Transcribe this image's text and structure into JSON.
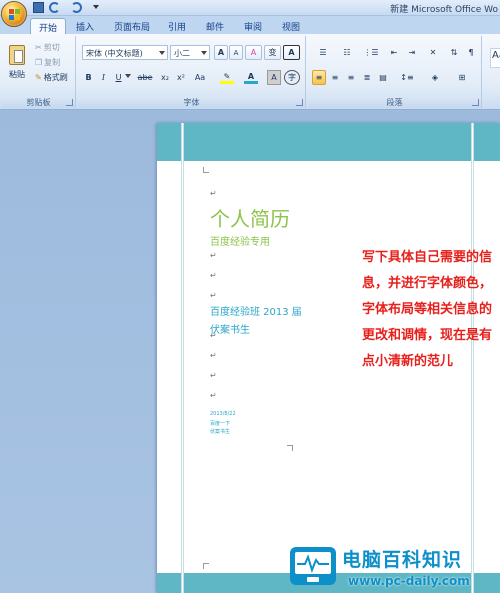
{
  "window": {
    "title": "新建 Microsoft Office Wo"
  },
  "tabs": [
    {
      "label": "开始",
      "active": true
    },
    {
      "label": "插入"
    },
    {
      "label": "页面布局"
    },
    {
      "label": "引用"
    },
    {
      "label": "邮件"
    },
    {
      "label": "审阅"
    },
    {
      "label": "视图"
    }
  ],
  "clipboard": {
    "paste_label": "粘贴",
    "cut_label": "剪切",
    "copy_label": "复制",
    "format_painter_label": "格式刷",
    "group_label": "剪贴板"
  },
  "font": {
    "font_name": "宋体 (中文标题)",
    "font_size": "小二",
    "group_label": "字体",
    "buttons": {
      "bold": "B",
      "italic": "I",
      "underline": "U",
      "strike": "abe",
      "subscript": "x₂",
      "superscript": "x²",
      "change_case": "Aa",
      "font_color": "A",
      "char_shading": "A",
      "grow": "A",
      "shrink": "A",
      "clear": "A",
      "phonetic": "变"
    }
  },
  "paragraph": {
    "group_label": "段落"
  },
  "styles": {
    "preview": "Aa"
  },
  "document": {
    "title": "个人简历",
    "subtitle": "百度经验专用",
    "line1": "百度经验班 2013 届",
    "line2": "伏案书生",
    "small1": "2013/8/22",
    "small2": "百度一下",
    "small3": "伏案书生",
    "mark": "↵"
  },
  "annotation": "写下具体自己需要的信息，并进行字体颜色，字体布局等相关信息的更改和调情，现在是有点小清新的范儿",
  "watermark": {
    "name": "电脑百科知识",
    "url": "www.pc-daily.com"
  },
  "colors": {
    "accent": "#5fb7c5",
    "title_green": "#8dc34a",
    "text_blue": "#2aa6c9",
    "annotation_red": "#e8201c",
    "logo_blue": "#0d8fc9"
  }
}
